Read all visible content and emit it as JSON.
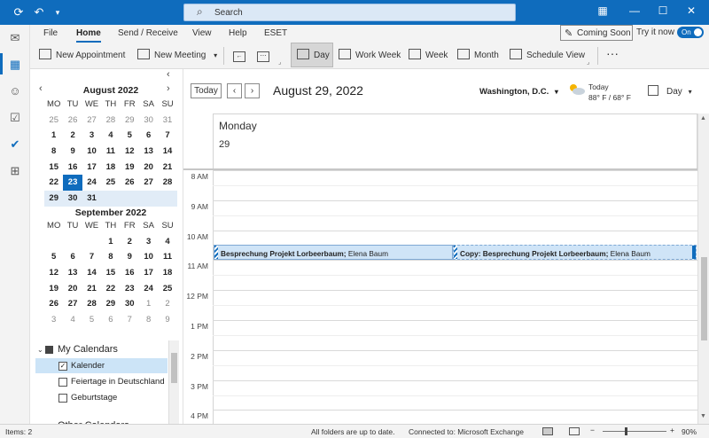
{
  "titlebar": {
    "search_placeholder": "Search",
    "icons": [
      "sync-icon",
      "undo-icon",
      "customize-icon",
      "coach-icon",
      "minimize-icon",
      "maximize-icon",
      "close-icon"
    ]
  },
  "tabs": [
    "File",
    "Home",
    "Send / Receive",
    "View",
    "Help",
    "ESET"
  ],
  "active_tab": "Home",
  "coming_soon": "Coming Soon",
  "try_it_now": "Try it now",
  "toggle_label": "On",
  "ribbon": {
    "new_appointment": "New Appointment",
    "new_meeting": "New Meeting",
    "day": "Day",
    "work_week": "Work Week",
    "week": "Week",
    "month": "Month",
    "schedule_view": "Schedule View",
    "more": "···"
  },
  "navigator": {
    "weekday_headers": [
      "MO",
      "TU",
      "WE",
      "TH",
      "FR",
      "SA",
      "SU"
    ],
    "months": [
      {
        "title": "August 2022",
        "weeks": [
          [
            "25",
            "26",
            "27",
            "28",
            "29",
            "30",
            "31"
          ],
          [
            "1",
            "2",
            "3",
            "4",
            "5",
            "6",
            "7"
          ],
          [
            "8",
            "9",
            "10",
            "11",
            "12",
            "13",
            "14"
          ],
          [
            "15",
            "16",
            "17",
            "18",
            "19",
            "20",
            "21"
          ],
          [
            "22",
            "23",
            "24",
            "25",
            "26",
            "27",
            "28"
          ],
          [
            "29",
            "30",
            "31",
            "",
            "",
            "",
            ""
          ]
        ]
      },
      {
        "title": "September 2022",
        "weeks": [
          [
            "",
            "",
            "",
            "1",
            "2",
            "3",
            "4"
          ],
          [
            "5",
            "6",
            "7",
            "8",
            "9",
            "10",
            "11"
          ],
          [
            "12",
            "13",
            "14",
            "15",
            "16",
            "17",
            "18"
          ],
          [
            "19",
            "20",
            "21",
            "22",
            "23",
            "24",
            "25"
          ],
          [
            "26",
            "27",
            "28",
            "29",
            "30",
            "1",
            "2"
          ],
          [
            "3",
            "4",
            "5",
            "6",
            "7",
            "8",
            "9"
          ]
        ]
      }
    ],
    "today": "23",
    "selected": "29"
  },
  "my_calendars": {
    "header": "My Calendars",
    "items": [
      {
        "label": "Kalender",
        "checked": true
      },
      {
        "label": "Feiertage in Deutschland",
        "checked": false
      },
      {
        "label": "Geburtstage",
        "checked": false
      }
    ],
    "next_group": "Other Calendars"
  },
  "calendar": {
    "today_button": "Today",
    "date_title": "August 29, 2022",
    "location": "Washington, D.C.",
    "weather_label": "Today",
    "weather_temp": "88° F / 68° F",
    "view_label": "Day",
    "day_name": "Monday",
    "day_number": "29",
    "hours": [
      "8 AM",
      "9 AM",
      "10 AM",
      "11 AM",
      "12 PM",
      "1 PM",
      "2 PM",
      "3 PM",
      "4 PM"
    ],
    "appointments": [
      {
        "title": "Besprechung Projekt Lorbeerbaum;",
        "organizer": "Elena Baum"
      },
      {
        "title": "Copy: Besprechung Projekt Lorbeerbaum;",
        "organizer": "Elena Baum"
      }
    ]
  },
  "status": {
    "items": "Items: 2",
    "sync": "All folders are up to date.",
    "connection": "Connected to: Microsoft Exchange",
    "zoom": "90%"
  },
  "colors": {
    "accent": "#0f6cbd",
    "appointment": "#cfe4f7"
  }
}
